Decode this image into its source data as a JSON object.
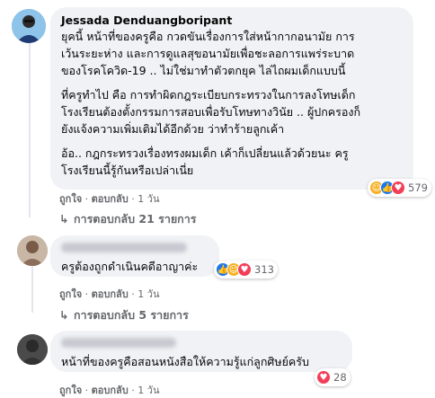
{
  "comments": [
    {
      "author": "Jessada Denduangboripant",
      "lines": [
        "ยุคนี้ หน้าที่ของครูคือ กวดขันเรื่องการใส่หน้ากากอนามัย การ",
        "เว้นระยะห่าง และการดูแลสุขอนามัยเพื่อชะลอการแพร่ระบาด",
        "ของโรคโควิด-19 .. ไม่ใช่มาทำตัวตกยุค ไล่ไถผมเด็กแบบนี้",
        "",
        "ที่ครูทำไป คือ การทำผิดกฎระเบียบกระทรวงในการลงโทษเด็ก",
        "โรงเรียนต้องตั้งกรรมการสอบเพื่อรับโทษทางวินัย .. ผู้ปกครองก็",
        "ยังแจ้งความเพิ่มเติมได้อีกด้วย ว่าทำร้ายลูกเค้า",
        "",
        "อ้อ.. กฎกระทรวงเรื่องทรงผมเด็ก เค้าก็เปลี่ยนแล้วด้วยนะ ครู",
        "โรงเรียนนี้รู้กันหรือเปล่าเนี่ย"
      ],
      "reactions": {
        "icons": [
          "care",
          "like",
          "love"
        ],
        "count": "579"
      },
      "actions": {
        "like": "ถูกใจ",
        "reply": "ตอบกลับ",
        "time": "1 วัน"
      },
      "replies_label": "การตอบกลับ 21 รายการ"
    },
    {
      "author": "",
      "lines": [
        "ครูต้องถูกดำเนินคดีอาญาค่ะ"
      ],
      "reactions": {
        "icons": [
          "like",
          "care",
          "love"
        ],
        "count": "313"
      },
      "actions": {
        "like": "ถูกใจ",
        "reply": "ตอบกลับ",
        "time": "1 วัน"
      },
      "replies_label": "การตอบกลับ 5 รายการ"
    },
    {
      "author": "",
      "lines": [
        "หน้าที่ของครูคือสอนหนังสือให้ความรู้แก่ลูกศิษย์ครับ"
      ],
      "reactions": {
        "icons": [
          "love"
        ],
        "count": "28"
      },
      "actions": {
        "like": "ถูกใจ",
        "reply": "ตอบกลับ",
        "time": "1 วัน"
      },
      "replies_label": ""
    }
  ],
  "colors": {
    "bubble": "#f0f2f5",
    "secondary_text": "#65676b",
    "like": "#1877f2",
    "love": "#f33e58",
    "care": "#f7b125"
  }
}
